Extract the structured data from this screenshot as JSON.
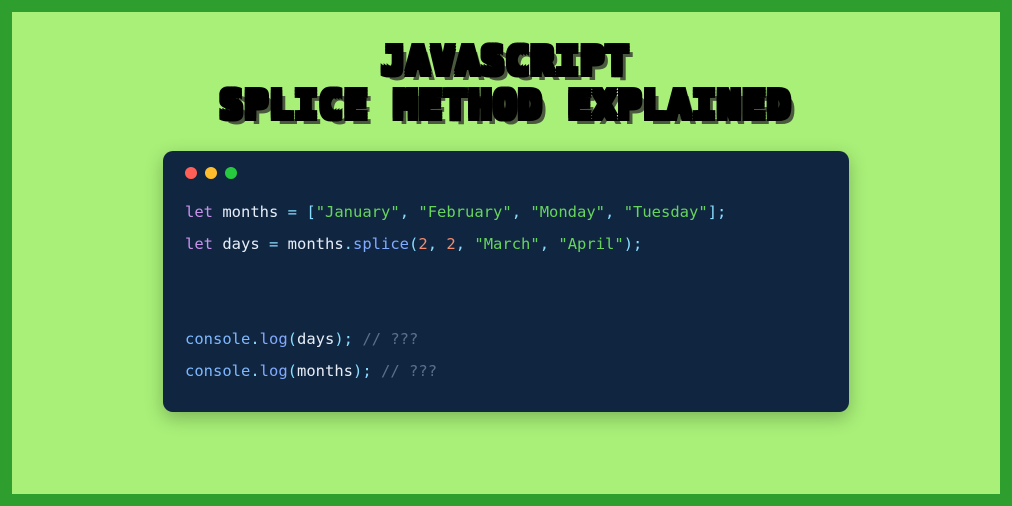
{
  "title": {
    "line1": "JAVASCRIPT",
    "line2": "SPLICE METHOD EXPLAINED"
  },
  "window": {
    "dot_red_name": "close-icon",
    "dot_yellow_name": "minimize-icon",
    "dot_green_name": "maximize-icon"
  },
  "code": {
    "line1": {
      "kw": "let",
      "var": "months",
      "eq": " = ",
      "open": "[",
      "s1": "\"January\"",
      "c1": ", ",
      "s2": "\"February\"",
      "c2": ", ",
      "s3": "\"Monday\"",
      "c3": ", ",
      "s4": "\"Tuesday\"",
      "close": "];"
    },
    "line2": {
      "kw": "let",
      "var": "days",
      "eq": " = ",
      "obj": "months",
      "dot": ".",
      "method": "splice",
      "open": "(",
      "n1": "2",
      "c1": ", ",
      "n2": "2",
      "c2": ", ",
      "s1": "\"March\"",
      "c3": ", ",
      "s2": "\"April\"",
      "close": ");"
    },
    "line4": {
      "obj": "console",
      "dot": ".",
      "method": "log",
      "open": "(",
      "var": "days",
      "close": ");",
      "sp": " ",
      "comment": "// ???"
    },
    "line5": {
      "obj": "console",
      "dot": ".",
      "method": "log",
      "open": "(",
      "var": "months",
      "close": ");",
      "sp": " ",
      "comment": "// ???"
    }
  }
}
